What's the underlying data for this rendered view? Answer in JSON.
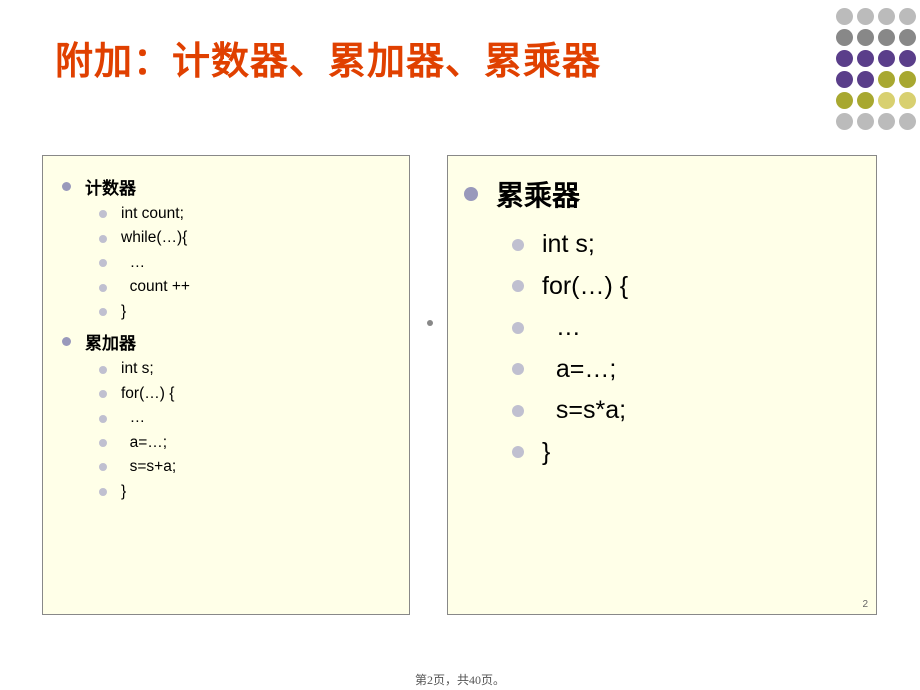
{
  "title": "附加：计数器、累加器、累乘器",
  "left": {
    "sections": [
      {
        "title": "计数器",
        "lines": [
          "int count;",
          "while(…){",
          "  …",
          "  count ++",
          "}"
        ]
      },
      {
        "title": "累加器",
        "lines": [
          "int s;",
          "for(…) {",
          "  …",
          "  a=…;",
          "  s=s+a;",
          "}"
        ]
      }
    ]
  },
  "right": {
    "title": "累乘器",
    "lines": [
      "int s;",
      "for(…) {",
      "  …",
      "  a=…;",
      "  s=s*a;",
      "}"
    ]
  },
  "page_num": "2",
  "footer": "第2页，共40页。"
}
